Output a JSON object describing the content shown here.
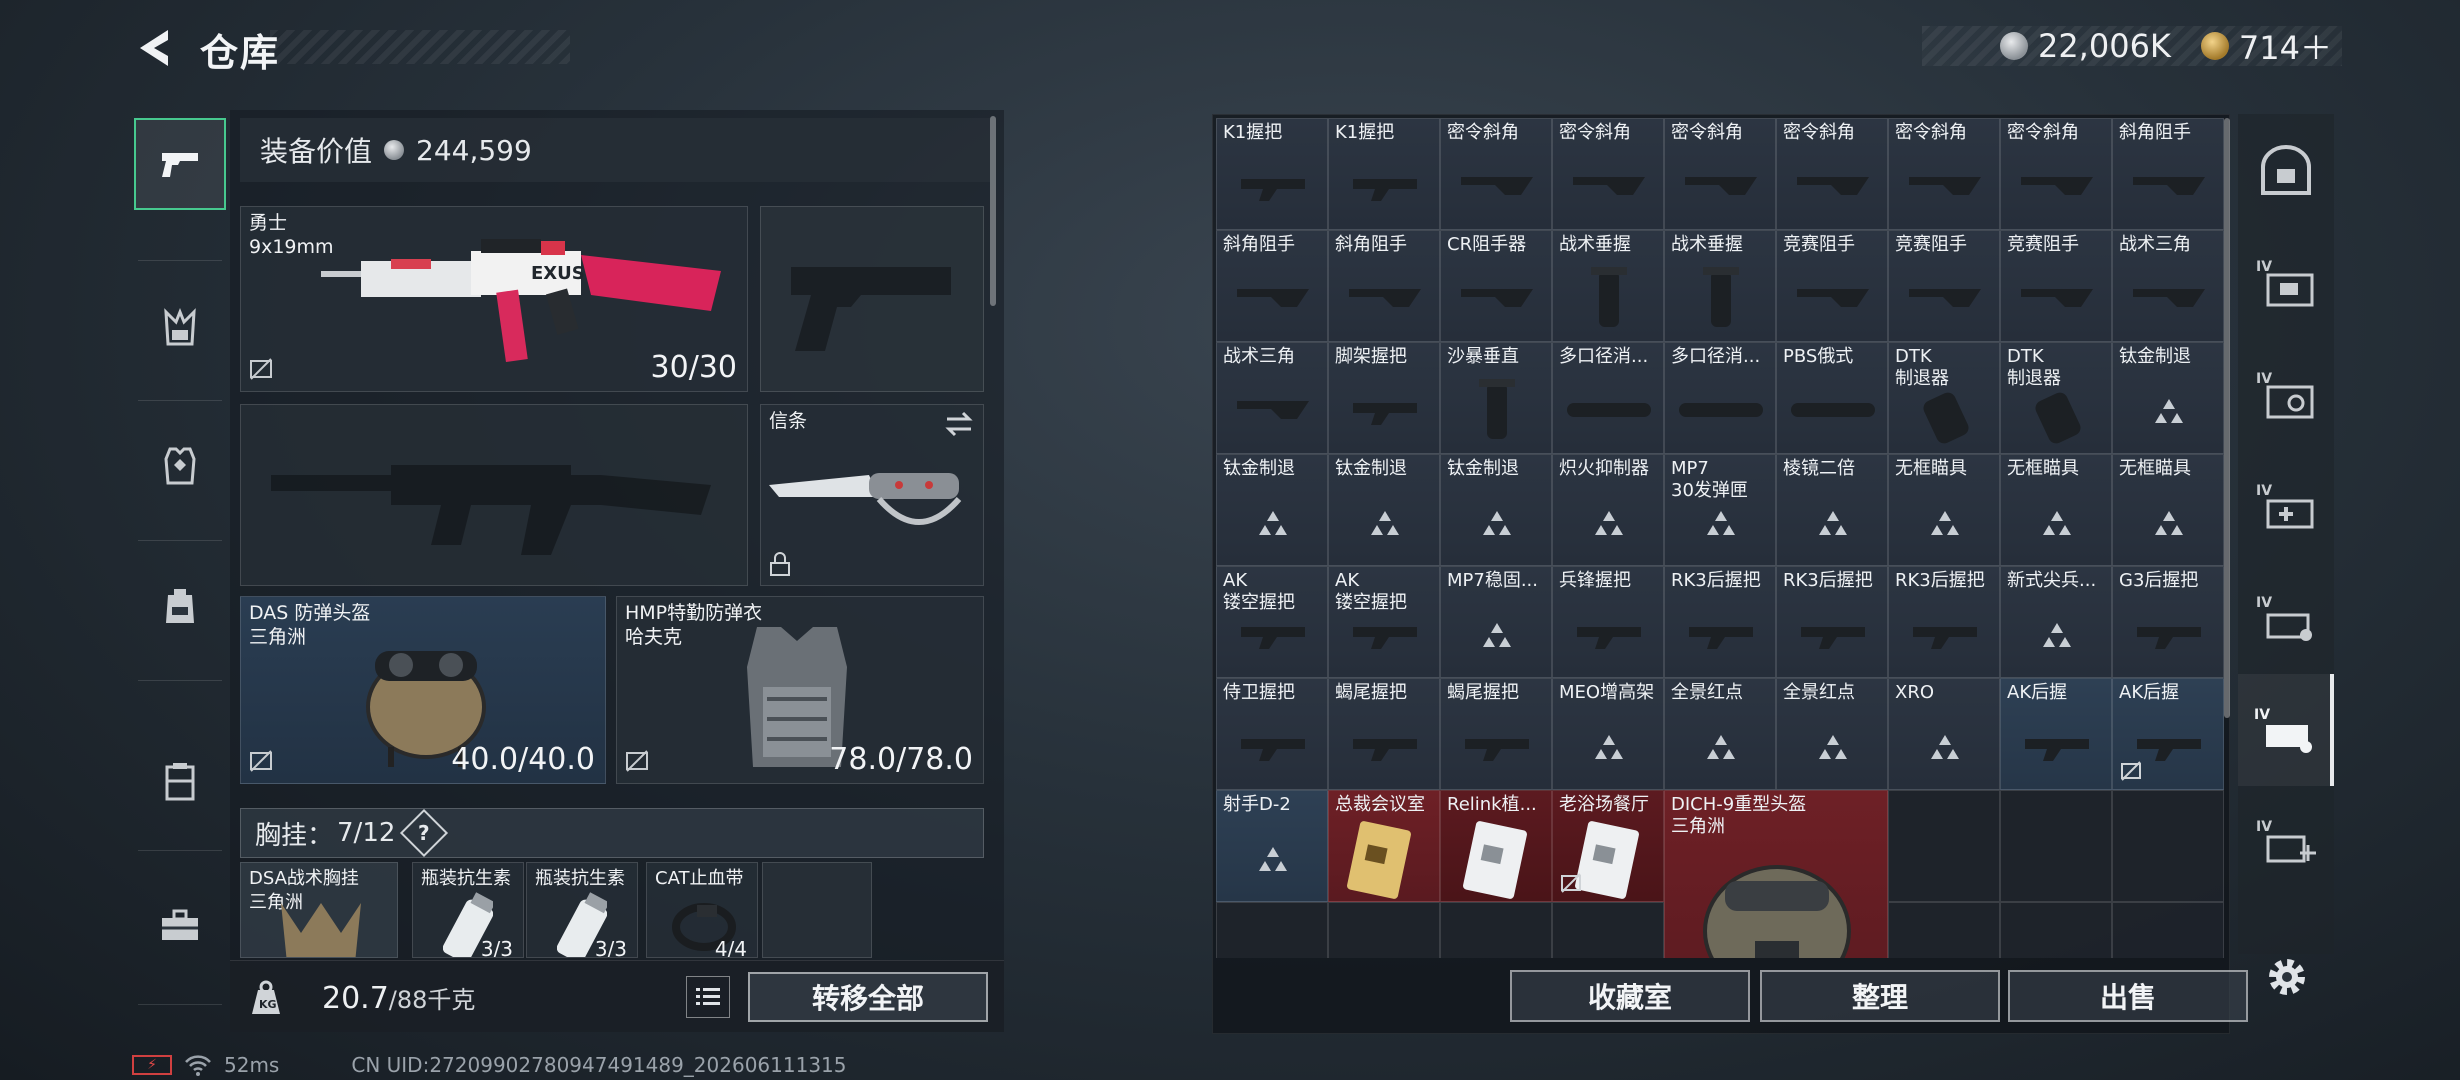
{
  "header": {
    "title": "仓库"
  },
  "currency": [
    {
      "icon": "silver-coin-icon",
      "value": "22,006K"
    },
    {
      "icon": "gold-coin-icon",
      "value": "714＋"
    }
  ],
  "left_nav": [
    {
      "id": "weapons",
      "icon": "pistol-icon",
      "active": true
    },
    {
      "id": "vests",
      "icon": "chest-rig-icon"
    },
    {
      "id": "armor",
      "icon": "armor-icon"
    },
    {
      "id": "backpack",
      "icon": "backpack-icon"
    },
    {
      "id": "container",
      "icon": "case-icon"
    },
    {
      "id": "toolbox",
      "icon": "toolbox-icon"
    }
  ],
  "equipment": {
    "value_label": "装备价值",
    "value": "244,599",
    "primary": {
      "name": "勇士\n9x19mm",
      "ammo": "30/30"
    },
    "melee": {
      "name": "信条"
    },
    "helmet": {
      "name": "DAS 防弹头盔\n三角洲",
      "durability": "40.0/40.0"
    },
    "armor": {
      "name": "HMP特勤防弹衣\n哈夫克",
      "durability": "78.0/78.0"
    },
    "vest_label": "胸挂：",
    "vest_capacity": "7/12",
    "vest_help": "?",
    "vest_items": [
      {
        "name": "DSA战术胸挂\n三角洲"
      },
      {
        "name": "瓶装抗生素",
        "count": "3/3"
      },
      {
        "name": "瓶装抗生素",
        "count": "3/3"
      },
      {
        "name": "CAT止血带",
        "count": "4/4"
      }
    ],
    "weight": "20.7",
    "weight_max": "/88千克",
    "transfer_all": "转移全部"
  },
  "storage": {
    "rows": [
      [
        "K1握把",
        "K1握把",
        "密令斜角",
        "密令斜角",
        "密令斜角",
        "密令斜角",
        "密令斜角",
        "密令斜角",
        "斜角阻手"
      ],
      [
        "斜角阻手",
        "斜角阻手",
        "CR阻手器",
        "战术垂握",
        "战术垂握",
        "竞赛阻手",
        "竞赛阻手",
        "竞赛阻手",
        "战术三角"
      ],
      [
        "战术三角",
        "脚架握把",
        "沙暴垂直",
        "多口径消...",
        "多口径消...",
        "PBS俄式",
        "DTK\n制退器",
        "DTK\n制退器",
        "钛金制退"
      ],
      [
        "钛金制退",
        "钛金制退",
        "钛金制退",
        "炽火抑制器",
        "MP7\n30发弹匣",
        "棱镜二倍",
        "无框瞄具",
        "无框瞄具",
        "无框瞄具"
      ],
      [
        "AK\n镂空握把",
        "AK\n镂空握把",
        "MP7稳固...",
        "兵锋握把",
        "RK3后握把",
        "RK3后握把",
        "RK3后握把",
        "新式尖兵...",
        "G3后握把"
      ],
      [
        "侍卫握把",
        "蝎尾握把",
        "蝎尾握把",
        "MEO增高架",
        "全景红点",
        "全景红点",
        "XRO",
        "AK后握",
        "AK后握"
      ]
    ],
    "last_row": [
      {
        "name": "射手D-2"
      },
      {
        "name": "总裁会议室"
      },
      {
        "name": "Relink植..."
      },
      {
        "name": "老浴场餐厅"
      },
      {
        "name": "DICH-9重型头盔\n三角洲"
      }
    ],
    "buttons": [
      "收藏室",
      "整理",
      "出售"
    ]
  },
  "right_nav": [
    {
      "icon": "safe-box-icon"
    },
    {
      "icon": "ammo-box-iv-icon"
    },
    {
      "icon": "keys-iv-icon"
    },
    {
      "icon": "medical-iv-icon"
    },
    {
      "icon": "tools-iv-icon"
    },
    {
      "icon": "attachments-iv-icon",
      "active": true
    },
    {
      "icon": "add-case-iv-icon"
    }
  ],
  "status": {
    "ping": "52ms",
    "uid": "CN UID:272099027809474914​89_202606111315"
  }
}
